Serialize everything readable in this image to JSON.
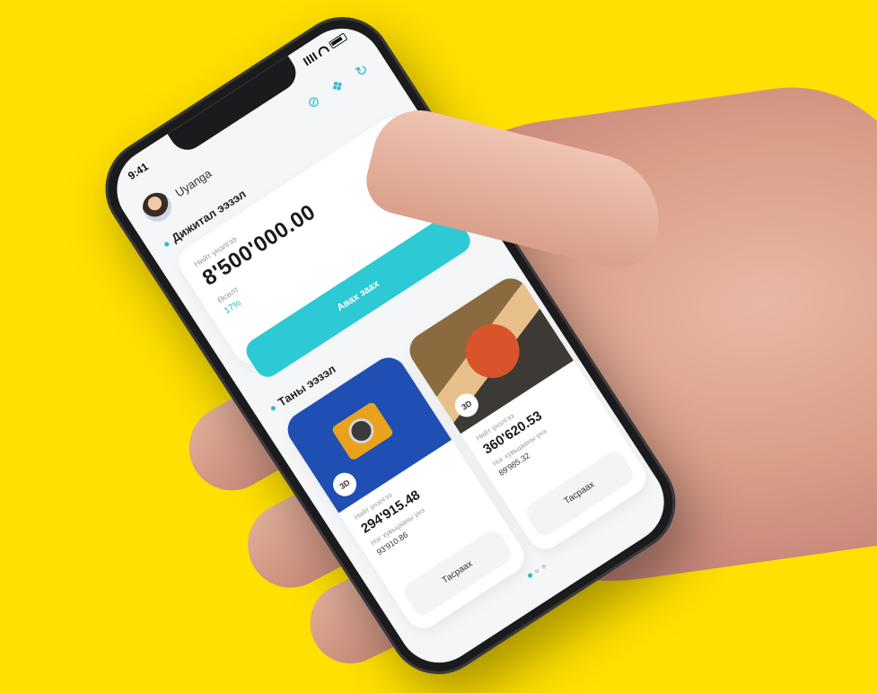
{
  "status_bar": {
    "time": "9:41"
  },
  "header": {
    "username": "Uyanga"
  },
  "digital": {
    "section_title": "Дижитал ээзэл",
    "label": "Нийт үнэлгээ",
    "amount": "8'500'000.00",
    "label2": "Өсөлт",
    "rate": "17%",
    "button_label": "Авах заах"
  },
  "mine": {
    "section_title": "Таны ээзэл",
    "cards": [
      {
        "badge": "3D",
        "label": "Нийт үнэлгээ",
        "amount": "294'915.48",
        "sub_label": "Нэг хувьцааны үнэ",
        "sub_value": "93'910.86",
        "button_label": "Тасраах"
      },
      {
        "badge": "3D",
        "label": "Нийт үнэлгээ",
        "amount": "360'620.53",
        "sub_label": "Нэг хувьцааны үнэ",
        "sub_value": "89'985.32",
        "button_label": "Тасраах"
      }
    ]
  },
  "colors": {
    "background": "#FFE000",
    "accent": "#2DC9D4",
    "camera_card": "#1F4FB3"
  },
  "icons": [
    "eye-off-icon",
    "gift-icon",
    "refresh-icon"
  ]
}
